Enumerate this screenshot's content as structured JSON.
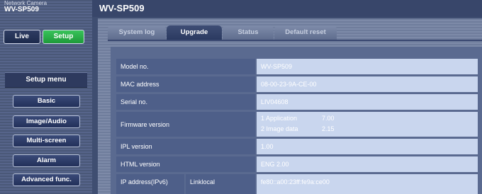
{
  "brand": {
    "line1": "Network Camera",
    "model": "WV-SP509"
  },
  "page_title": "WV-SP509",
  "mode": {
    "live": "Live",
    "setup": "Setup"
  },
  "setup_menu": {
    "title": "Setup menu",
    "items": [
      "Basic",
      "Image/Audio",
      "Multi-screen",
      "Alarm",
      "Advanced func."
    ]
  },
  "tabs": [
    {
      "label": "System log",
      "active": false
    },
    {
      "label": "Upgrade",
      "active": true
    },
    {
      "label": "Status",
      "active": false
    },
    {
      "label": "Default reset",
      "active": false
    }
  ],
  "info": {
    "model_no": {
      "label": "Model no.",
      "value": "WV-SP509"
    },
    "mac_address": {
      "label": "MAC address",
      "value": "08-00-23-9A-CE-00"
    },
    "serial_no": {
      "label": "Serial no.",
      "value": "LIV04608"
    },
    "firmware": {
      "label": "Firmware version",
      "line1_label": "1 Application",
      "line1_value": "7.00",
      "line2_label": "2 Image data",
      "line2_value": "2.15"
    },
    "ipl_version": {
      "label": "IPL version",
      "value": "1.00"
    },
    "html_version": {
      "label": "HTML version",
      "value": "ENG 2.00"
    },
    "ipv6": {
      "label": "IP address(IPv6)",
      "sub_label": "Linklocal",
      "value": "fe80::a00:23ff:fe9a:ce00"
    }
  }
}
